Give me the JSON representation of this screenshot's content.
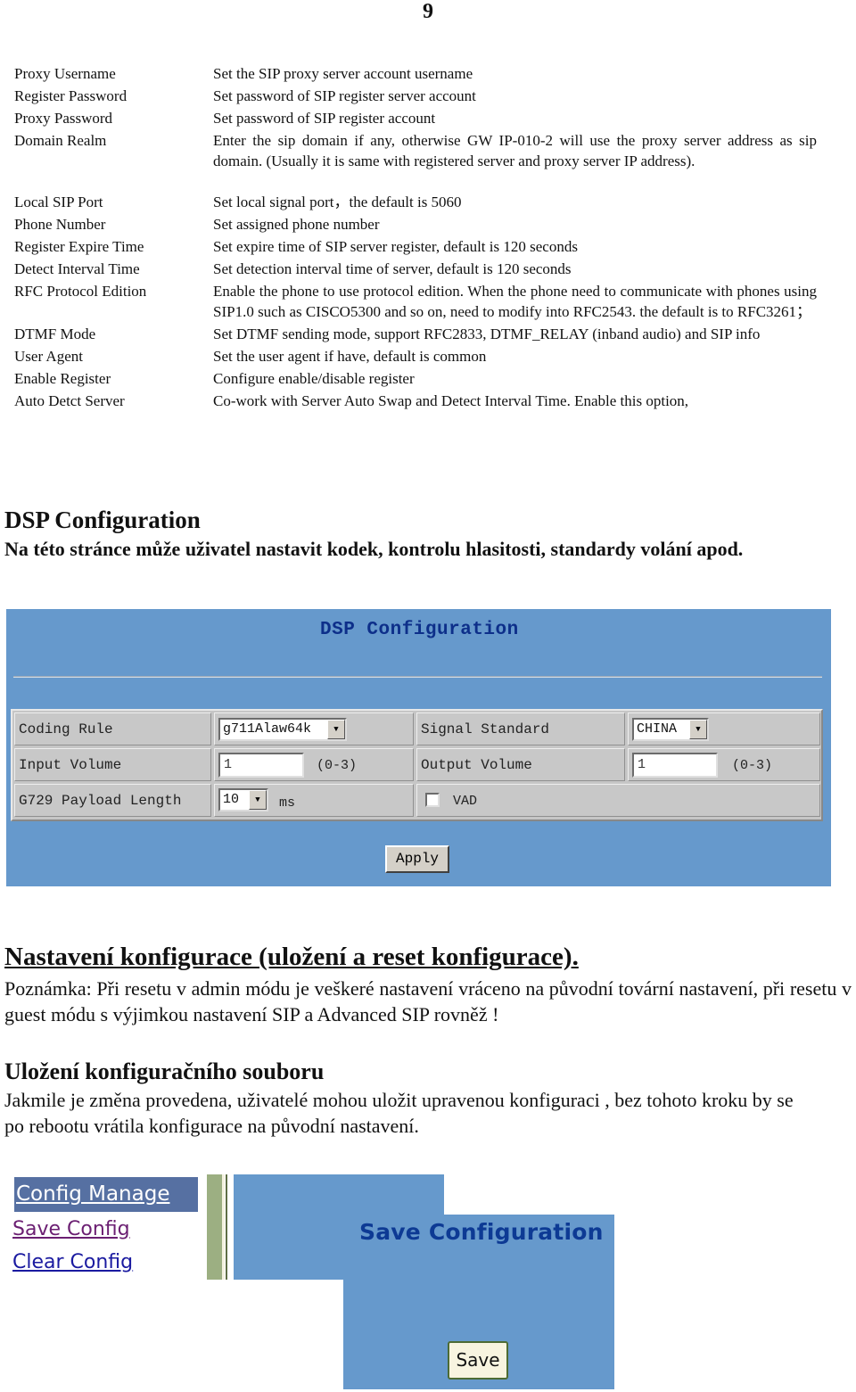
{
  "page_number": "9",
  "sip_params_1": [
    {
      "term": "Proxy Username",
      "desc": "Set the SIP proxy server account username"
    },
    {
      "term": "Register Password",
      "desc": "Set password of SIP register server account"
    },
    {
      "term": "Proxy Password",
      "desc": "Set password of SIP register account"
    },
    {
      "term": "Domain Realm",
      "desc": "Enter the sip domain if any, otherwise GW IP-010-2 will use the proxy server address as sip domain. (Usually it is same with registered server and proxy server IP address)."
    }
  ],
  "sip_params_2": [
    {
      "term": "Local SIP Port",
      "desc": "Set local signal port，the default is 5060"
    },
    {
      "term": "Phone Number",
      "desc": "Set assigned phone number"
    },
    {
      "term": "Register Expire Time",
      "desc": "Set expire time of SIP server register, default is 120 seconds"
    },
    {
      "term": "Detect Interval Time",
      "desc": "Set detection interval time of server, default is 120 seconds"
    },
    {
      "term": "RFC Protocol Edition",
      "desc": "Enable the phone to use protocol edition. When the phone need to communicate with phones using SIP1.0 such as CISCO5300 and so on, need to modify into RFC2543. the default is to RFC3261；"
    },
    {
      "term": "DTMF Mode",
      "desc": "Set DTMF sending mode, support RFC2833, DTMF_RELAY (inband audio) and SIP info"
    },
    {
      "term": "User Agent",
      "desc": "Set the user agent if have, default is common"
    },
    {
      "term": "Enable Register",
      "desc": "Configure enable/disable register"
    },
    {
      "term": "Auto Detct Server",
      "desc": "Co-work with Server Auto Swap and Detect Interval Time. Enable this option,"
    }
  ],
  "dsp_section": {
    "heading": "DSP Configuration",
    "intro": "Na této stránce  může uživatel  nastavit kodek, kontrolu hlasitosti, standardy volání apod."
  },
  "dsp_screen": {
    "title": "DSP Configuration",
    "coding_rule_label": "Coding Rule",
    "coding_rule_value": "g711Alaw64k",
    "signal_standard_label": "Signal Standard",
    "signal_standard_value": "CHINA",
    "input_volume_label": "Input Volume",
    "input_volume_value": "1",
    "input_volume_range": "(0-3)",
    "output_volume_label": "Output Volume",
    "output_volume_value": "1",
    "output_volume_range": "(0-3)",
    "g729_label": "G729 Payload Length",
    "g729_value": "10",
    "g729_unit": "ms",
    "vad_label": "VAD",
    "vad_checked": false,
    "apply_label": "Apply",
    "dropdown_arrow": "▼"
  },
  "config_section": {
    "heading": "Nastavení konfigurace (uložení a reset konfigurace).",
    "note": "Poznámka: Při resetu v admin módu je veškeré nastavení  vráceno na původní tovární nastavení, při resetu v guest módu s výjimkou nastavení  SIP a Advanced SIP rovněž !"
  },
  "save_section": {
    "heading": "Uložení konfiguračního souboru",
    "body": "Jakmile je změna provedena, uživatelé mohou uložit upravenou konfiguraci ,  bez tohoto kroku by se po rebootu vrátila konfigurace na původní nastavení."
  },
  "config_screen": {
    "menu_heading": "Config Manage",
    "menu_items": [
      "Save Config",
      "Clear Config"
    ],
    "title": "Save Configuration",
    "save_label": "Save"
  }
}
